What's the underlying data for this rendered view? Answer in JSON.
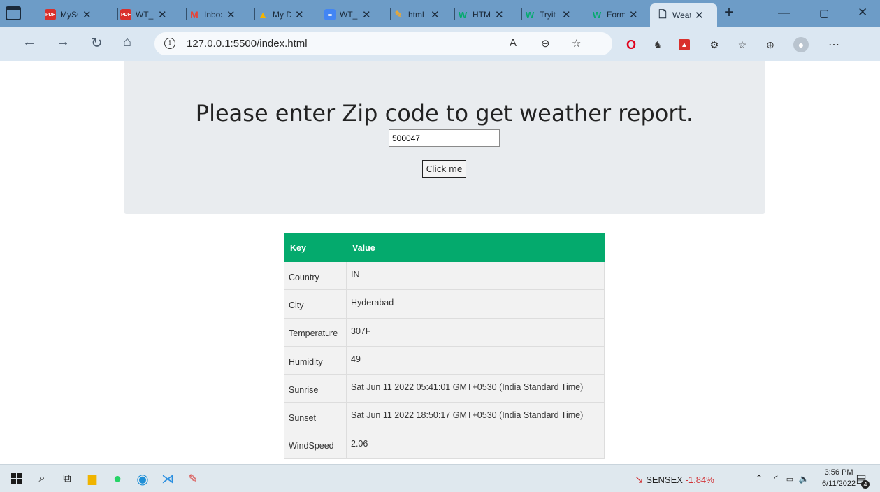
{
  "tabs": [
    {
      "title": "MySQL",
      "icon": "pdf-icon",
      "color": "#d9302c",
      "x": 0
    },
    {
      "title": "WT_",
      "icon": "pdf-icon",
      "color": "#d9302c",
      "x": 0
    },
    {
      "title": "Inbox",
      "icon": "gmail-icon",
      "color": "#e94235",
      "x": 0
    },
    {
      "title": "My Drive",
      "icon": "drive-icon",
      "color": "#1ea362",
      "x": 0
    },
    {
      "title": "WT_",
      "icon": "docs-icon",
      "color": "#4285f4",
      "x": 0
    },
    {
      "title": "html",
      "icon": "leaf-icon",
      "color": "#e8a838",
      "x": 0
    },
    {
      "title": "HTML",
      "icon": "w3schools-icon",
      "color": "#04aa6d",
      "x": 0
    },
    {
      "title": "Tryit",
      "icon": "w3schools-icon",
      "color": "#04aa6d",
      "x": 0
    },
    {
      "title": "Form",
      "icon": "w3schools-icon",
      "color": "#04aa6d",
      "x": 0
    },
    {
      "title": "Weather",
      "icon": "page-icon",
      "color": "#1b2a3a",
      "x": 0
    }
  ],
  "address": {
    "url": "127.0.0.1:5500/index.html"
  },
  "page": {
    "heading": "Please enter Zip code to get weather report.",
    "zip_value": "500047",
    "button_label": "Click me",
    "table": {
      "headers": [
        "Key",
        "Value"
      ],
      "rows": [
        [
          "Country",
          "IN"
        ],
        [
          "City",
          "Hyderabad"
        ],
        [
          "Temperature",
          "307F"
        ],
        [
          "Humidity",
          "49"
        ],
        [
          "Sunrise",
          "Sat Jun 11 2022 05:41:01 GMT+0530 (India Standard Time)"
        ],
        [
          "Sunset",
          "Sat Jun 11 2022 18:50:17 GMT+0530 (India Standard Time)"
        ],
        [
          "WindSpeed",
          "2.06"
        ]
      ]
    }
  },
  "taskbar": {
    "sensex_label": "SENSEX",
    "sensex_change": "-1.84%",
    "time": "3:56 PM",
    "date": "6/11/2022",
    "notification_count": "4"
  },
  "colors": {
    "tabbar": "#6d9cc7",
    "toolbar": "#dbe7f2",
    "table_header": "#04aa6d",
    "jumbotron": "#e9ecef"
  }
}
